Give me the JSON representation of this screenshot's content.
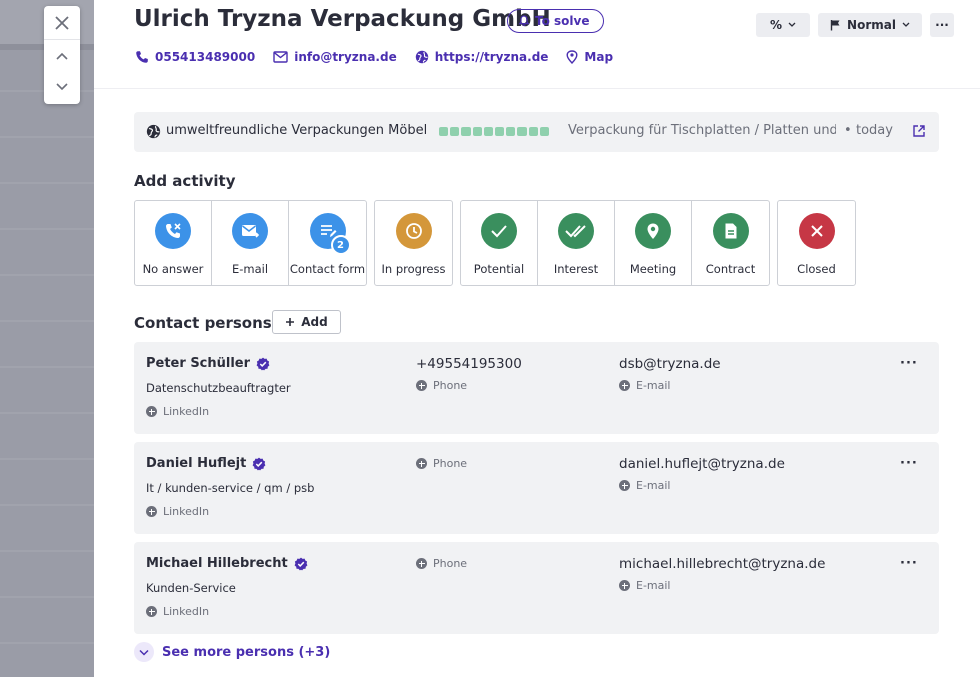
{
  "company": {
    "name": "Ulrich Tryzna Verpackung GmbH",
    "status": "To solve"
  },
  "toolbar": {
    "percent_label": "%",
    "priority_label": "Normal",
    "more_label": "···"
  },
  "contacts": {
    "phone": "055413489000",
    "email": "info@tryzna.de",
    "website": "https://tryzna.de",
    "map": "Map"
  },
  "info_bar": {
    "tag": "umweltfreundliche Verpackungen Möbel",
    "progress": 1.0,
    "description": "Verpackung für Tischplatten / Platten und Bauteile",
    "dot": "•",
    "when": "today"
  },
  "add_activity": {
    "title": "Add activity",
    "groups": [
      [
        {
          "label": "No answer",
          "color": "#3c92e8",
          "icon": "phone-missed-icon"
        },
        {
          "label": "E-mail",
          "color": "#3c92e8",
          "icon": "email-send-icon"
        },
        {
          "label": "Contact form",
          "color": "#3c92e8",
          "icon": "form-icon",
          "badge": "2"
        }
      ],
      [
        {
          "label": "In progress",
          "color": "#d4973a",
          "icon": "clock-icon"
        }
      ],
      [
        {
          "label": "Potential",
          "color": "#3a8f5e",
          "icon": "check-icon"
        },
        {
          "label": "Interest",
          "color": "#3a8f5e",
          "icon": "double-check-icon"
        },
        {
          "label": "Meeting",
          "color": "#3a8f5e",
          "icon": "map-pin-icon"
        },
        {
          "label": "Contract",
          "color": "#3a8f5e",
          "icon": "document-icon"
        }
      ],
      [
        {
          "label": "Closed",
          "color": "#c63745",
          "icon": "close-circle-icon"
        }
      ]
    ]
  },
  "contact_persons": {
    "title": "Contact persons",
    "add_label": "Add",
    "persons": [
      {
        "name": "Peter Schüller",
        "role": "Datenschutzbeauftragter",
        "linkedin": "LinkedIn",
        "phone": "+49554195300",
        "phone_label": "Phone",
        "email": "dsb@tryzna.de",
        "email_label": "E-mail",
        "more": "···"
      },
      {
        "name": "Daniel Huflejt",
        "role": "It / kunden-service / qm / psb",
        "linkedin": "LinkedIn",
        "phone": "",
        "phone_label": "Phone",
        "email": "daniel.huflejt@tryzna.de",
        "email_label": "E-mail",
        "more": "···"
      },
      {
        "name": "Michael Hillebrecht",
        "role": "Kunden-Service",
        "linkedin": "LinkedIn",
        "phone": "",
        "phone_label": "Phone",
        "email": "michael.hillebrecht@tryzna.de",
        "email_label": "E-mail",
        "more": "···"
      }
    ],
    "see_more": "See more persons (+3)"
  },
  "colors": {
    "accent": "#4a2fb0",
    "progress": "#8fd0ad"
  }
}
